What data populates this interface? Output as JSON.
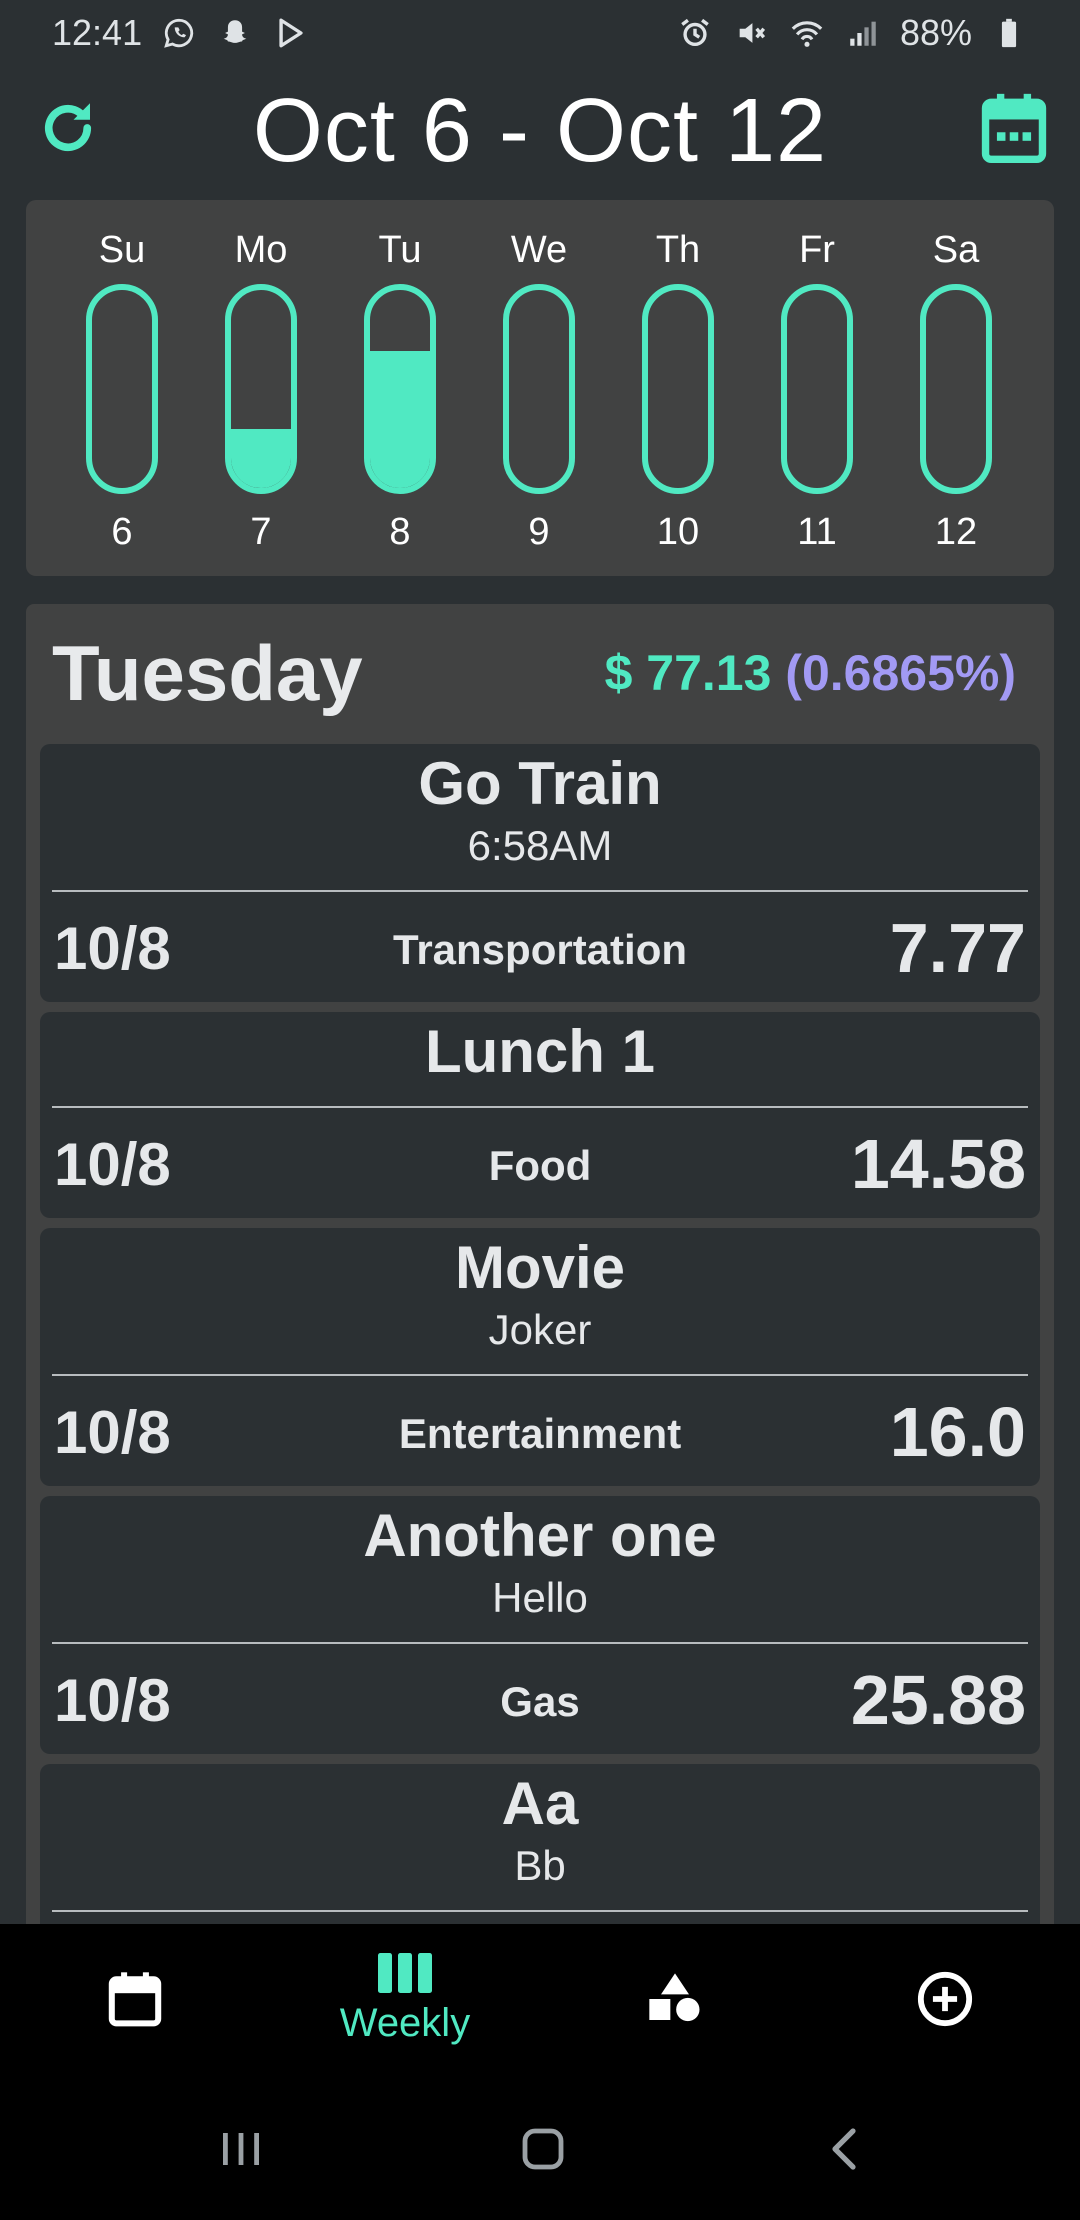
{
  "status_bar": {
    "time": "12:41",
    "battery": "88%",
    "icons_left": [
      "whatsapp-icon",
      "snapchat-icon",
      "play-store-icon"
    ],
    "icons_right": [
      "alarm-icon",
      "mute-icon",
      "wifi-icon",
      "signal-icon",
      "battery-icon"
    ]
  },
  "header": {
    "title": "Oct 6 - Oct 12",
    "refresh_icon": "refresh-icon",
    "calendar_icon": "calendar-icon"
  },
  "week": {
    "days": [
      {
        "name": "Su",
        "num": "6",
        "fill": 0.0
      },
      {
        "name": "Mo",
        "num": "7",
        "fill": 0.3
      },
      {
        "name": "Tu",
        "num": "8",
        "fill": 0.69
      },
      {
        "name": "We",
        "num": "9",
        "fill": 0.0
      },
      {
        "name": "Th",
        "num": "10",
        "fill": 0.0
      },
      {
        "name": "Fr",
        "num": "11",
        "fill": 0.0
      },
      {
        "name": "Sa",
        "num": "12",
        "fill": 0.0
      }
    ]
  },
  "detail": {
    "day_title": "Tuesday",
    "total_amount": "$ 77.13",
    "total_pct": "(0.6865%)",
    "items": [
      {
        "name": "Go Train",
        "note": "6:58AM",
        "date": "10/8",
        "category": "Transportation",
        "amount": "7.77"
      },
      {
        "name": "Lunch 1",
        "note": "",
        "date": "10/8",
        "category": "Food",
        "amount": "14.58"
      },
      {
        "name": "Movie",
        "note": "Joker",
        "date": "10/8",
        "category": "Entertainment",
        "amount": "16.0"
      },
      {
        "name": "Another one",
        "note": "Hello",
        "date": "10/8",
        "category": "Gas",
        "amount": "25.88"
      },
      {
        "name": "Aa",
        "note": "Bb",
        "date": "",
        "category": "",
        "amount": ""
      }
    ]
  },
  "bottom_nav": {
    "items": [
      {
        "icon": "calendar-icon",
        "label": ""
      },
      {
        "icon": "weekly-bars-icon",
        "label": "Weekly"
      },
      {
        "icon": "shapes-icon",
        "label": ""
      },
      {
        "icon": "add-circle-icon",
        "label": ""
      }
    ]
  },
  "colors": {
    "accent": "#50e9c2",
    "percent": "#a29af4",
    "background": "#2b3033",
    "card": "#414242"
  }
}
